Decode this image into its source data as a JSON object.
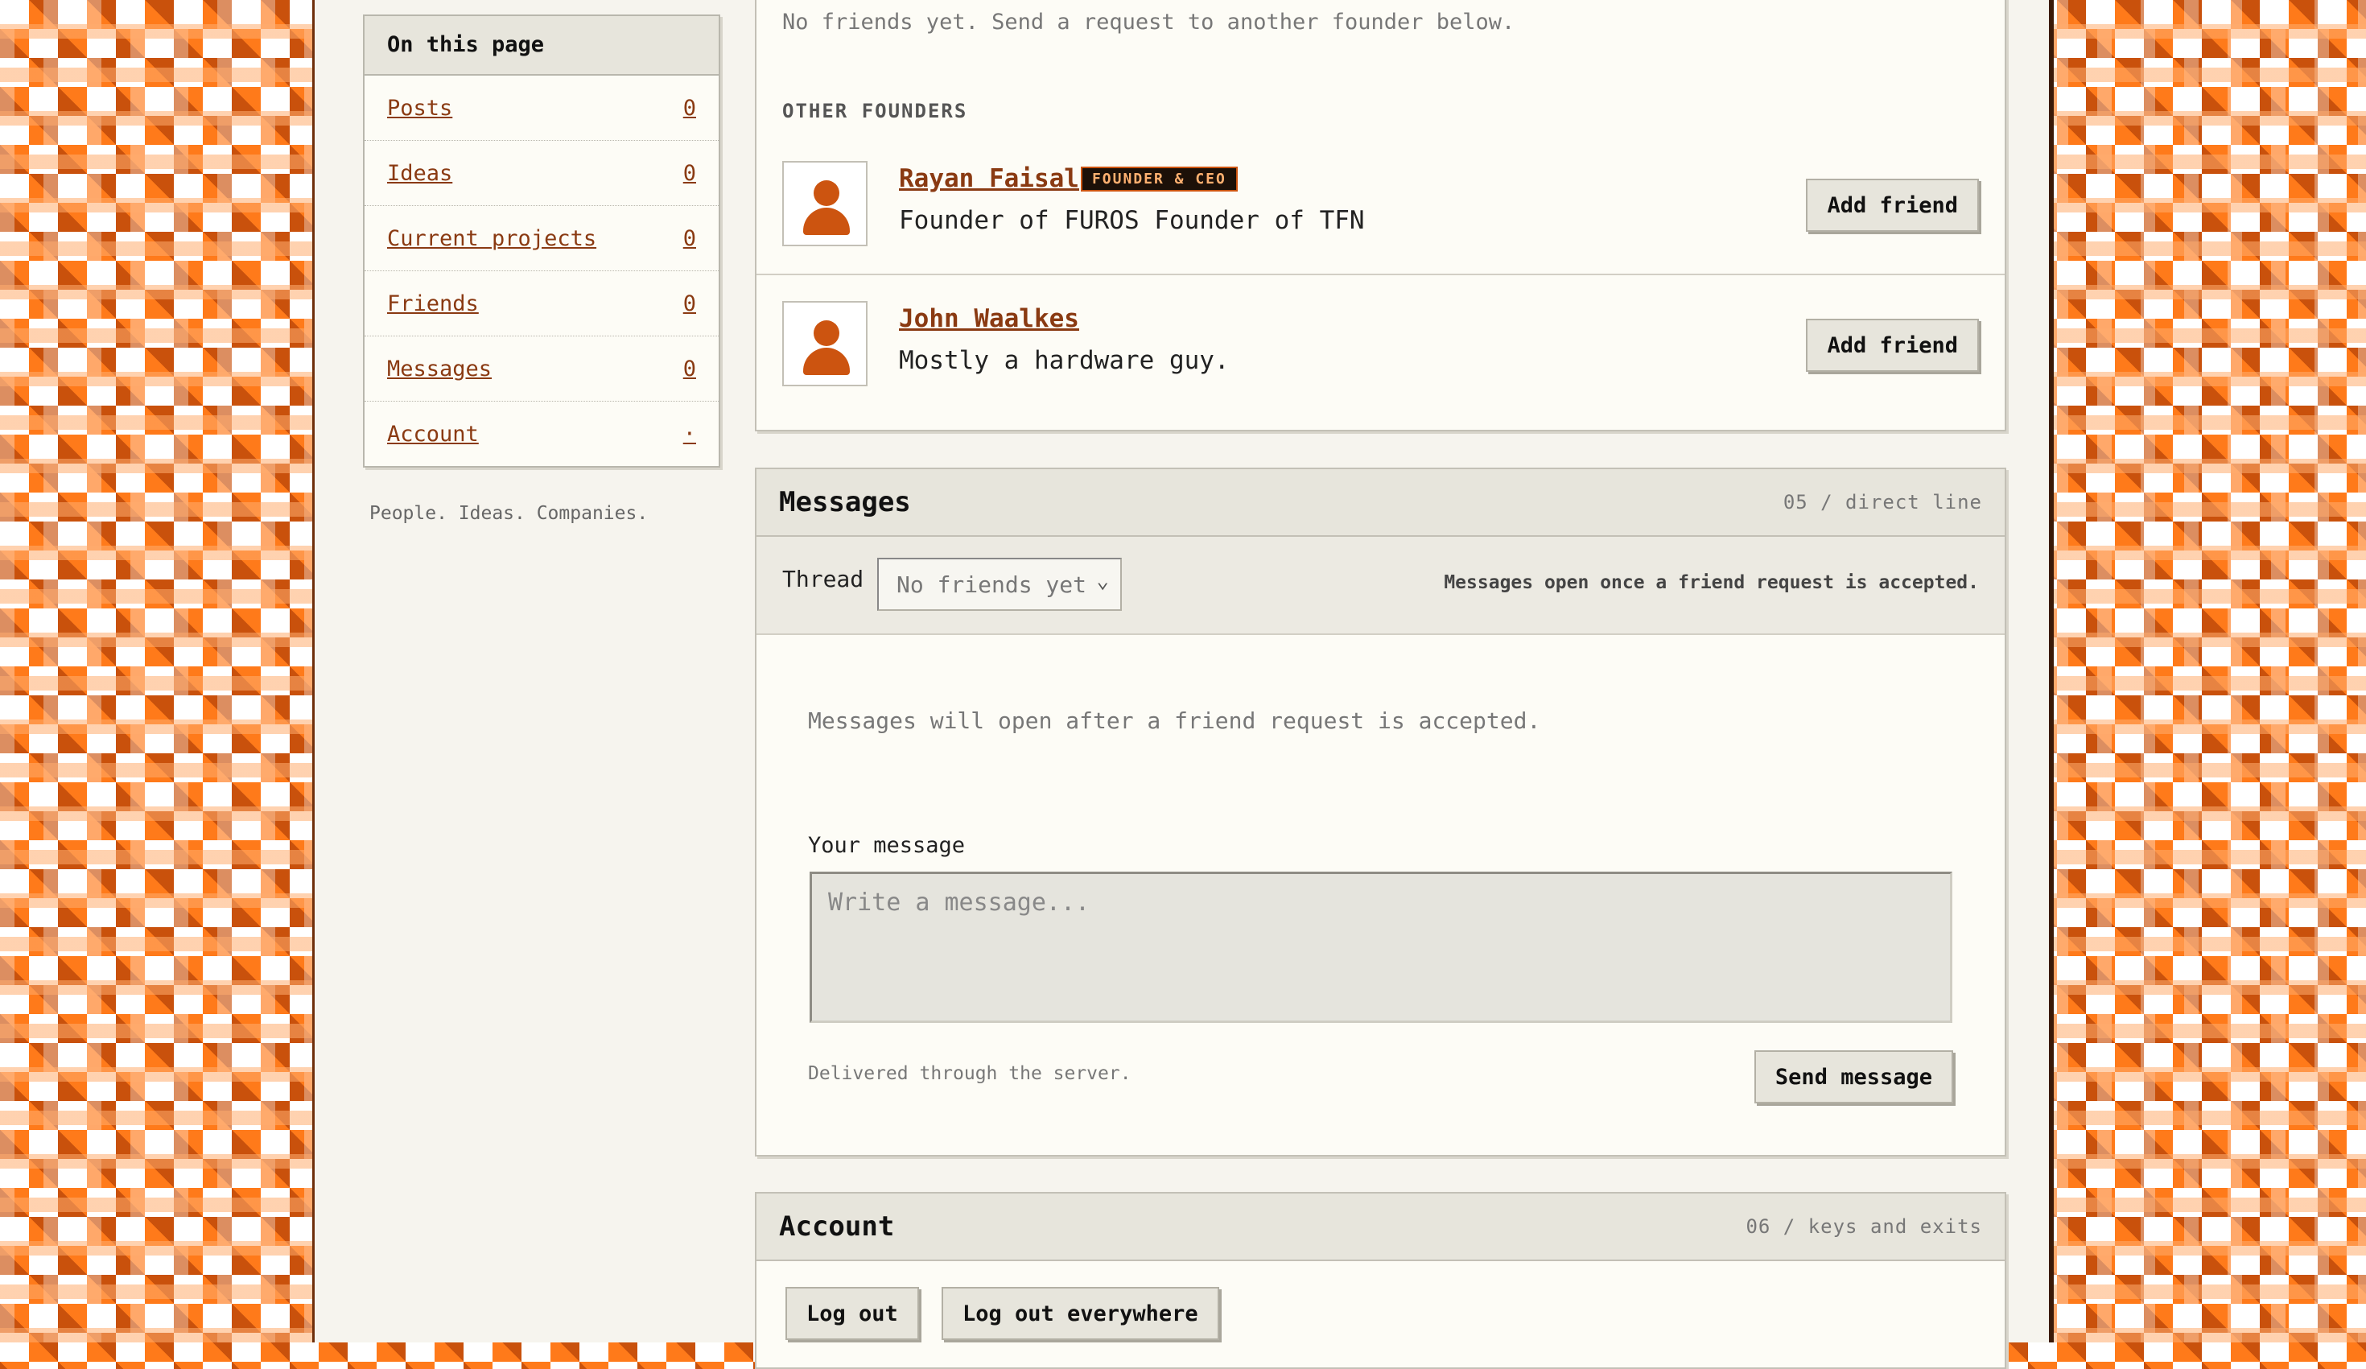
{
  "nav": {
    "title": "On this page",
    "items": [
      {
        "label": "Posts",
        "count": "0"
      },
      {
        "label": "Ideas",
        "count": "0"
      },
      {
        "label": "Current projects",
        "count": "0"
      },
      {
        "label": "Friends",
        "count": "0"
      },
      {
        "label": "Messages",
        "count": "0"
      },
      {
        "label": "Account",
        "count": "·"
      }
    ],
    "tagline": "People. Ideas. Companies."
  },
  "friends": {
    "empty_text": "No friends yet. Send a request to another founder below.",
    "other_heading": "OTHER FOUNDERS",
    "founders": [
      {
        "name": "Rayan Faisal",
        "badge": "FOUNDER & CEO",
        "bio": "Founder of FUROS Founder of TFN",
        "action": "Add friend"
      },
      {
        "name": "John Waalkes",
        "badge": "",
        "bio": "Mostly a hardware guy.",
        "action": "Add friend"
      }
    ]
  },
  "messages": {
    "title": "Messages",
    "meta": "05 / direct line",
    "thread_label": "Thread",
    "thread_selected": "No friends yet",
    "notice": "Messages open once a friend request is accepted.",
    "empty_text": "Messages will open after a friend request is accepted.",
    "your_message_label": "Your message",
    "placeholder": "Write a message...",
    "delivery_note": "Delivered through the server.",
    "send_label": "Send message"
  },
  "account": {
    "title": "Account",
    "meta": "06 / keys and exits",
    "logout_label": "Log out",
    "logout_all_label": "Log out everywhere"
  },
  "colors": {
    "accent": "#cc5410",
    "link": "#8a3a12",
    "panel": "#fdfcf6",
    "header": "#e7e5dc"
  }
}
